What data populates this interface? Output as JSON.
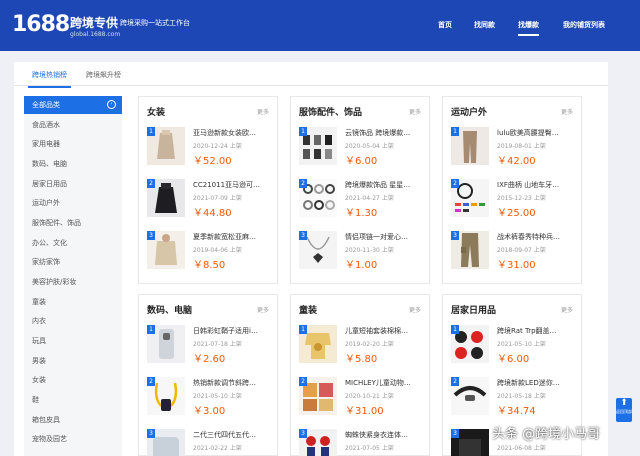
{
  "header": {
    "logo_number": "1688",
    "brand": "跨境专供",
    "url": "global.1688.com",
    "slogan": "跨境采购一站式工作台",
    "nav": [
      "首页",
      "找同款",
      "找爆款",
      "我的铺货列表"
    ]
  },
  "tabs": [
    "跨境热销榜",
    "跨境飙升榜"
  ],
  "sidebar": [
    "全部品类",
    "食品酒水",
    "家用电器",
    "数码、电脑",
    "居家日用品",
    "运动户外",
    "服饰配件、饰品",
    "办公、文化",
    "家纺家饰",
    "美容护肤/彩妆",
    "童装",
    "内衣",
    "玩具",
    "男装",
    "女装",
    "鞋",
    "箱包皮具",
    "宠物及园艺"
  ],
  "more_label": "更多",
  "categories": [
    {
      "title": "女装",
      "products": [
        {
          "rank": "1",
          "name": "亚马逊新款女装欧…",
          "date": "2020-12-24 上架",
          "price": "￥52.00"
        },
        {
          "rank": "2",
          "name": "CC21011亚马逊可…",
          "date": "2021-07-09 上架",
          "price": "￥44.80"
        },
        {
          "rank": "3",
          "name": "夏季新款宽松亚麻…",
          "date": "2019-04-06 上架",
          "price": "￥8.50"
        }
      ]
    },
    {
      "title": "服饰配件、饰品",
      "products": [
        {
          "rank": "1",
          "name": "云镜饰品 跨境爆款…",
          "date": "2020-05-04 上架",
          "price": "￥6.00"
        },
        {
          "rank": "2",
          "name": "跨境爆款饰品 星星…",
          "date": "2021-04-27 上架",
          "price": "￥1.30"
        },
        {
          "rank": "3",
          "name": "情侣项链一对爱心…",
          "date": "2020-11-30 上架",
          "price": "￥1.00"
        }
      ]
    },
    {
      "title": "运动户外",
      "products": [
        {
          "rank": "1",
          "name": "lulu欧美高腰提臀…",
          "date": "2019-08-01 上架",
          "price": "￥42.00"
        },
        {
          "rank": "2",
          "name": "IXF曲柄 山地车牙…",
          "date": "2015-12-23 上架",
          "price": "￥25.00"
        },
        {
          "rank": "3",
          "name": "战术裤春秀特种兵…",
          "date": "2018-09-07 上架",
          "price": "￥31.00"
        }
      ]
    },
    {
      "title": "数码、电脑",
      "products": [
        {
          "rank": "1",
          "name": "日韩彩虹鞘子适用i…",
          "date": "2021-07-18 上架",
          "price": "￥2.60"
        },
        {
          "rank": "2",
          "name": "热销新款调节斜跨…",
          "date": "2021-05-10 上架",
          "price": "￥3.00"
        },
        {
          "rank": "3",
          "name": "二代三代四代五代…",
          "date": "2021-02-22 上架",
          "price": ""
        }
      ]
    },
    {
      "title": "童装",
      "products": [
        {
          "rank": "1",
          "name": "儿童短袖套装棉棉…",
          "date": "2019-02-20 上架",
          "price": "￥5.80"
        },
        {
          "rank": "2",
          "name": "MICHLEY儿童动物…",
          "date": "2020-10-21 上架",
          "price": "￥31.00"
        },
        {
          "rank": "3",
          "name": "蜘蛛侠紧身衣连体…",
          "date": "2021-07-05 上架",
          "price": ""
        }
      ]
    },
    {
      "title": "居家日用品",
      "products": [
        {
          "rank": "1",
          "name": "跨境Rat Trp翻盖…",
          "date": "2021-05-10 上架",
          "price": "￥6.00"
        },
        {
          "rank": "2",
          "name": "跨境新款LED迷你…",
          "date": "2021-05-18 上架",
          "price": "￥34.74"
        },
        {
          "rank": "3",
          "name": "",
          "date": "2021-06-08 上架",
          "price": ""
        }
      ]
    }
  ],
  "float_button": "返回顶部",
  "watermark": "头条 @跨境小马哥",
  "colors": {
    "header": "#1d47b5",
    "accent": "#1d6fe6",
    "price": "#f05a0a"
  }
}
